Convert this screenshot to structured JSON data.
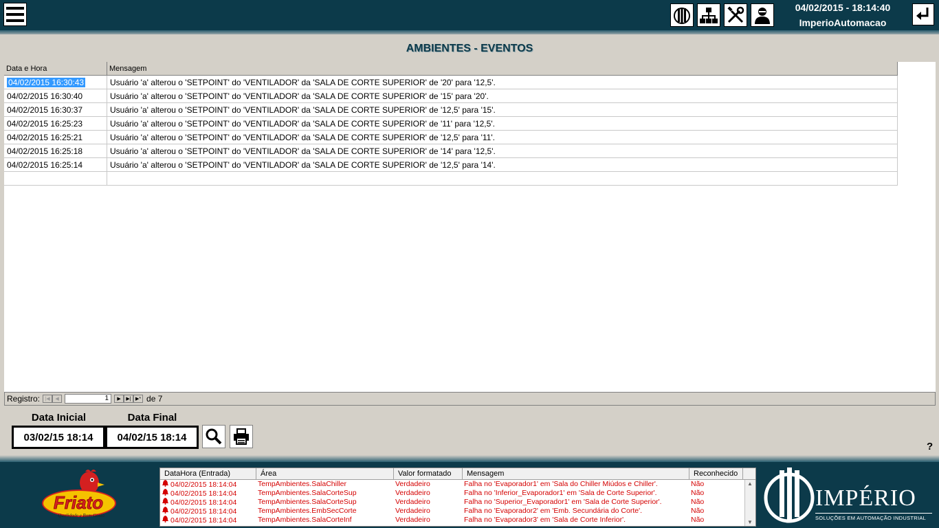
{
  "header": {
    "datetime": "04/02/2015 - 18:14:40",
    "username": "ImperioAutomacao",
    "icons": [
      "menu-icon",
      "brand-icon",
      "network-icon",
      "tools-icon",
      "user-icon",
      "back-icon"
    ]
  },
  "page": {
    "title": "AMBIENTES - EVENTOS"
  },
  "grid": {
    "columns": [
      "Data e Hora",
      "Mensagem"
    ],
    "rows": [
      {
        "date": "04/02/2015 16:30:43",
        "message": "Usuário 'a' alterou o 'SETPOINT' do 'VENTILADOR' da 'SALA DE CORTE SUPERIOR' de '20' para '12,5'."
      },
      {
        "date": "04/02/2015 16:30:40",
        "message": "Usuário 'a' alterou o 'SETPOINT' do 'VENTILADOR' da 'SALA DE CORTE SUPERIOR' de '15' para '20'."
      },
      {
        "date": "04/02/2015 16:30:37",
        "message": "Usuário 'a' alterou o 'SETPOINT' do 'VENTILADOR' da 'SALA DE CORTE SUPERIOR' de '12,5' para '15'."
      },
      {
        "date": "04/02/2015 16:25:23",
        "message": "Usuário 'a' alterou o 'SETPOINT' do 'VENTILADOR' da 'SALA DE CORTE SUPERIOR' de '11' para '12,5'."
      },
      {
        "date": "04/02/2015 16:25:21",
        "message": "Usuário 'a' alterou o 'SETPOINT' do 'VENTILADOR' da 'SALA DE CORTE SUPERIOR' de '12,5' para '11'."
      },
      {
        "date": "04/02/2015 16:25:18",
        "message": "Usuário 'a' alterou o 'SETPOINT' do 'VENTILADOR' da 'SALA DE CORTE SUPERIOR' de '14' para '12,5'."
      },
      {
        "date": "04/02/2015 16:25:14",
        "message": "Usuário 'a' alterou o 'SETPOINT' do 'VENTILADOR' da 'SALA DE CORTE SUPERIOR' de '12,5' para '14'."
      },
      {
        "date": "",
        "message": ""
      }
    ]
  },
  "navigator": {
    "label": "Registro:",
    "current": "1",
    "total_text": "de 7"
  },
  "filter": {
    "start_label": "Data Inicial",
    "end_label": "Data Final",
    "start_value": "03/02/15 18:14",
    "end_value": "04/02/15 18:14",
    "help": "?"
  },
  "alarms": {
    "columns": [
      "DataHora (Entrada)",
      "Área",
      "Valor formatado",
      "Mensagem",
      "Reconhecido"
    ],
    "rows": [
      {
        "time": "04/02/2015 18:14:04",
        "area": "TempAmbientes.SalaChiller",
        "value": "Verdadeiro",
        "message": "Falha no 'Evaporador1' em 'Sala do Chiller Miúdos e Chiller'.",
        "ack": "Não"
      },
      {
        "time": "04/02/2015 18:14:04",
        "area": "TempAmbientes.SalaCorteSup",
        "value": "Verdadeiro",
        "message": "Falha no 'Inferior_Evaporador1' em 'Sala de Corte Superior'.",
        "ack": "Não"
      },
      {
        "time": "04/02/2015 18:14:04",
        "area": "TempAmbientes.SalaCorteSup",
        "value": "Verdadeiro",
        "message": "Falha no 'Superior_Evaporador1' em 'Sala de Corte Superior'.",
        "ack": "Não"
      },
      {
        "time": "04/02/2015 18:14:04",
        "area": "TempAmbientes.EmbSecCorte",
        "value": "Verdadeiro",
        "message": "Falha no 'Evaporador2' em 'Emb. Secundária do Corte'.",
        "ack": "Não"
      },
      {
        "time": "04/02/2015 18:14:04",
        "area": "TempAmbientes.SalaCorteInf",
        "value": "Verdadeiro",
        "message": "Falha no 'Evaporador3' em 'Sala de Corte Inferior'.",
        "ack": "Não"
      }
    ]
  },
  "logos": {
    "left_brand": "Friato",
    "left_tagline": "Qualidade e Bom Gosto",
    "right_brand": "IMPÉRIO",
    "right_tagline": "SOLUÇÕES EM AUTOMAÇÃO INDUSTRIAL"
  },
  "colors": {
    "header_bg": "#0c3a4a",
    "alarm_text": "#d40000",
    "selection": "#3399ff"
  }
}
